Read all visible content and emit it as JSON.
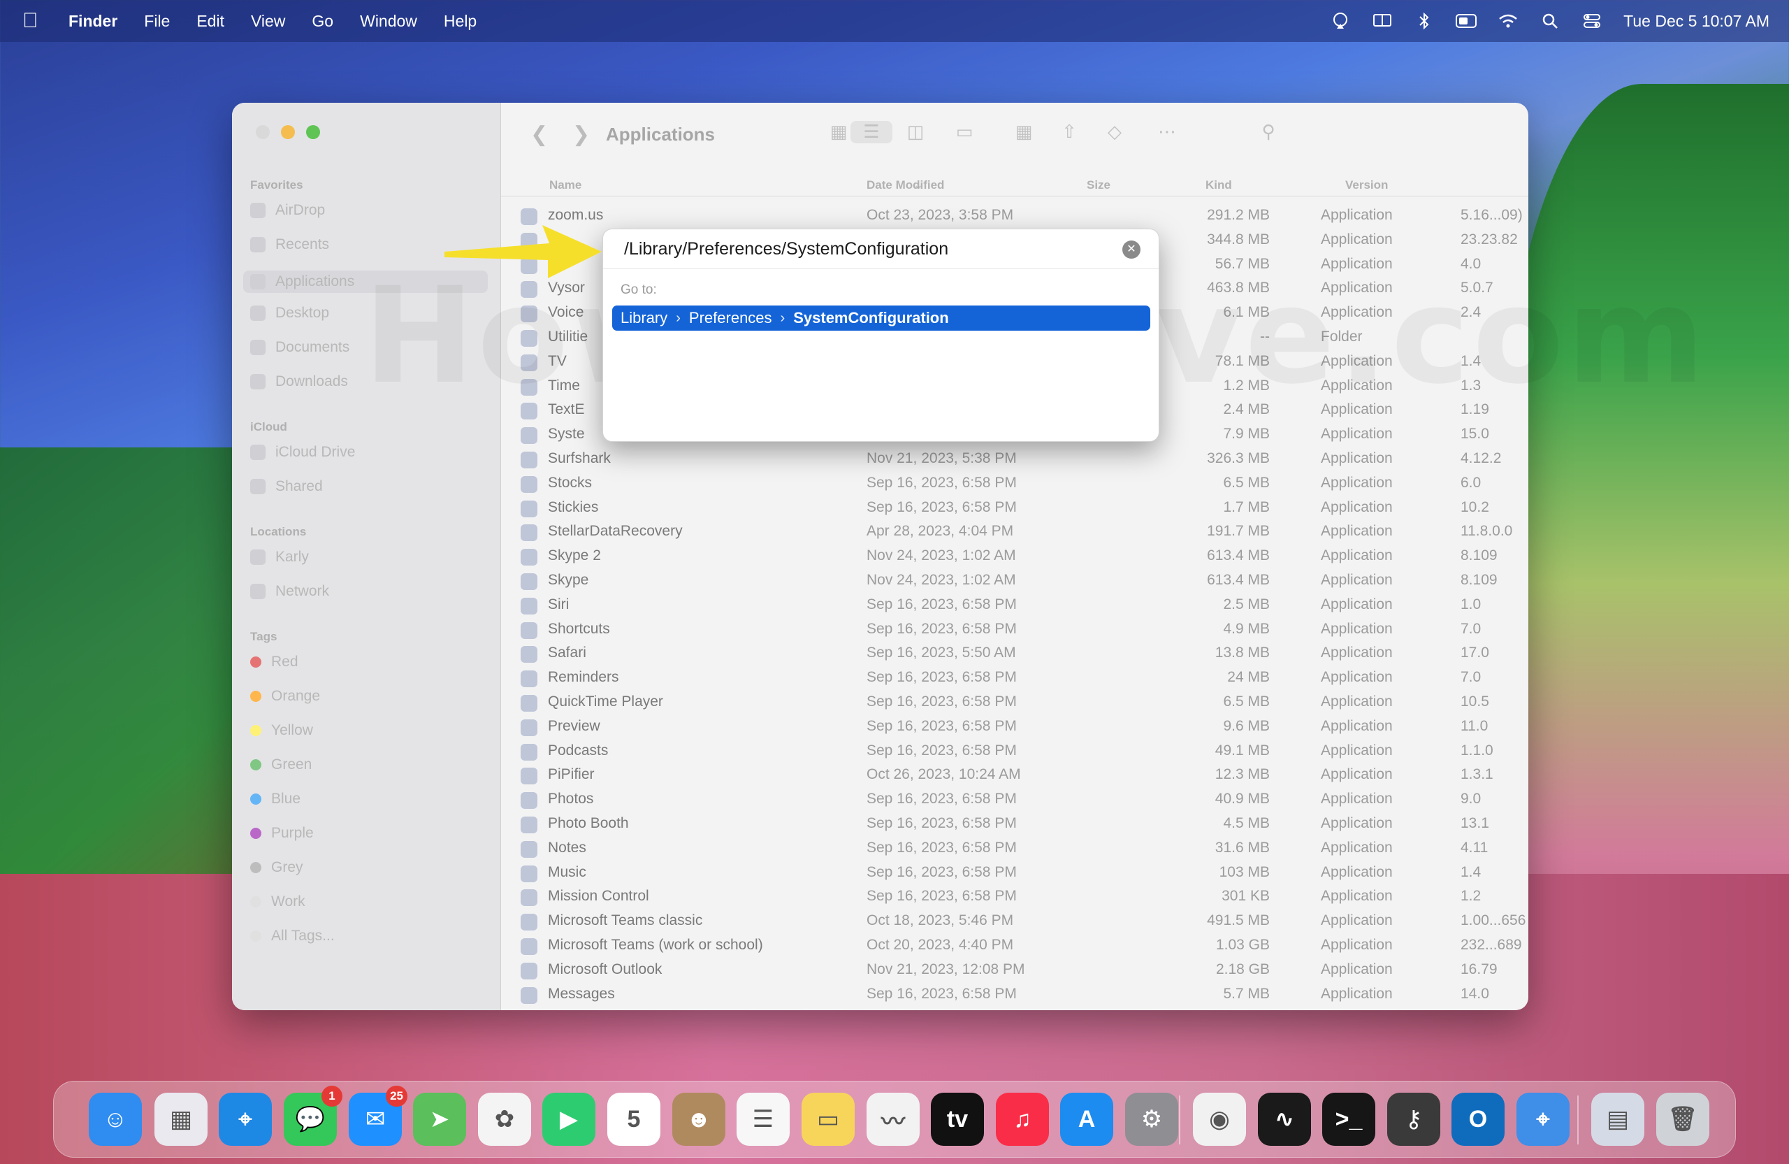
{
  "menubar": {
    "app": "Finder",
    "menus": [
      "File",
      "Edit",
      "View",
      "Go",
      "Window",
      "Help"
    ],
    "clock": "Tue Dec 5  10:07 AM",
    "status_icons": [
      "airplay-icon",
      "screen-mirroring-icon",
      "bluetooth-icon",
      "battery-icon",
      "wifi-icon",
      "search-icon",
      "control-center-icon"
    ]
  },
  "window": {
    "title": "Applications",
    "sidebar": {
      "favorites_label": "Favorites",
      "favorites": [
        "AirDrop",
        "Recents",
        "Applications",
        "Desktop",
        "Documents",
        "Downloads"
      ],
      "icloud_label": "iCloud",
      "icloud": [
        "iCloud Drive",
        "Shared"
      ],
      "locations_label": "Locations",
      "locations": [
        "Karly",
        "Network"
      ],
      "tags_label": "Tags",
      "tags": [
        "Red",
        "Orange",
        "Yellow",
        "Green",
        "Blue",
        "Purple",
        "Grey",
        "Work",
        "All Tags..."
      ],
      "tag_colors": [
        "#e57373",
        "#ffb74d",
        "#fff176",
        "#81c784",
        "#64b5f6",
        "#ba68c8",
        "#bdbdbd",
        "#e0e0e0",
        "#e0e0e0"
      ]
    },
    "columns": {
      "name": "Name",
      "date": "Date Modified",
      "size": "Size",
      "kind": "Kind",
      "version": "Version"
    },
    "rows": [
      {
        "name": "zoom.us",
        "date": "Oct 23, 2023, 3:58 PM",
        "size": "291.2 MB",
        "kind": "Application",
        "version": "5.16...09)"
      },
      {
        "name": "",
        "date": "",
        "size": "344.8 MB",
        "kind": "Application",
        "version": "23.23.82"
      },
      {
        "name": "",
        "date": "",
        "size": "56.7 MB",
        "kind": "Application",
        "version": "4.0"
      },
      {
        "name": "Vysor",
        "date": "",
        "size": "463.8 MB",
        "kind": "Application",
        "version": "5.0.7"
      },
      {
        "name": "Voice",
        "date": "",
        "size": "6.1 MB",
        "kind": "Application",
        "version": "2.4"
      },
      {
        "name": "Utilitie",
        "date": "",
        "size": "--",
        "kind": "Folder",
        "version": ""
      },
      {
        "name": "TV",
        "date": "",
        "size": "78.1 MB",
        "kind": "Application",
        "version": "1.4"
      },
      {
        "name": "Time",
        "date": "",
        "size": "1.2 MB",
        "kind": "Application",
        "version": "1.3"
      },
      {
        "name": "TextE",
        "date": "",
        "size": "2.4 MB",
        "kind": "Application",
        "version": "1.19"
      },
      {
        "name": "Syste",
        "date": "",
        "size": "7.9 MB",
        "kind": "Application",
        "version": "15.0"
      },
      {
        "name": "Surfshark",
        "date": "Nov 21, 2023, 5:38 PM",
        "size": "326.3 MB",
        "kind": "Application",
        "version": "4.12.2"
      },
      {
        "name": "Stocks",
        "date": "Sep 16, 2023, 6:58 PM",
        "size": "6.5 MB",
        "kind": "Application",
        "version": "6.0"
      },
      {
        "name": "Stickies",
        "date": "Sep 16, 2023, 6:58 PM",
        "size": "1.7 MB",
        "kind": "Application",
        "version": "10.2"
      },
      {
        "name": "StellarDataRecovery",
        "date": "Apr 28, 2023, 4:04 PM",
        "size": "191.7 MB",
        "kind": "Application",
        "version": "11.8.0.0"
      },
      {
        "name": "Skype 2",
        "date": "Nov 24, 2023, 1:02 AM",
        "size": "613.4 MB",
        "kind": "Application",
        "version": "8.109"
      },
      {
        "name": "Skype",
        "date": "Nov 24, 2023, 1:02 AM",
        "size": "613.4 MB",
        "kind": "Application",
        "version": "8.109"
      },
      {
        "name": "Siri",
        "date": "Sep 16, 2023, 6:58 PM",
        "size": "2.5 MB",
        "kind": "Application",
        "version": "1.0"
      },
      {
        "name": "Shortcuts",
        "date": "Sep 16, 2023, 6:58 PM",
        "size": "4.9 MB",
        "kind": "Application",
        "version": "7.0"
      },
      {
        "name": "Safari",
        "date": "Sep 16, 2023, 5:50 AM",
        "size": "13.8 MB",
        "kind": "Application",
        "version": "17.0"
      },
      {
        "name": "Reminders",
        "date": "Sep 16, 2023, 6:58 PM",
        "size": "24 MB",
        "kind": "Application",
        "version": "7.0"
      },
      {
        "name": "QuickTime Player",
        "date": "Sep 16, 2023, 6:58 PM",
        "size": "6.5 MB",
        "kind": "Application",
        "version": "10.5"
      },
      {
        "name": "Preview",
        "date": "Sep 16, 2023, 6:58 PM",
        "size": "9.6 MB",
        "kind": "Application",
        "version": "11.0"
      },
      {
        "name": "Podcasts",
        "date": "Sep 16, 2023, 6:58 PM",
        "size": "49.1 MB",
        "kind": "Application",
        "version": "1.1.0"
      },
      {
        "name": "PiPifier",
        "date": "Oct 26, 2023, 10:24 AM",
        "size": "12.3 MB",
        "kind": "Application",
        "version": "1.3.1"
      },
      {
        "name": "Photos",
        "date": "Sep 16, 2023, 6:58 PM",
        "size": "40.9 MB",
        "kind": "Application",
        "version": "9.0"
      },
      {
        "name": "Photo Booth",
        "date": "Sep 16, 2023, 6:58 PM",
        "size": "4.5 MB",
        "kind": "Application",
        "version": "13.1"
      },
      {
        "name": "Notes",
        "date": "Sep 16, 2023, 6:58 PM",
        "size": "31.6 MB",
        "kind": "Application",
        "version": "4.11"
      },
      {
        "name": "Music",
        "date": "Sep 16, 2023, 6:58 PM",
        "size": "103 MB",
        "kind": "Application",
        "version": "1.4"
      },
      {
        "name": "Mission Control",
        "date": "Sep 16, 2023, 6:58 PM",
        "size": "301 KB",
        "kind": "Application",
        "version": "1.2"
      },
      {
        "name": "Microsoft Teams classic",
        "date": "Oct 18, 2023, 5:46 PM",
        "size": "491.5 MB",
        "kind": "Application",
        "version": "1.00...656"
      },
      {
        "name": "Microsoft Teams (work or school)",
        "date": "Oct 20, 2023, 4:40 PM",
        "size": "1.03 GB",
        "kind": "Application",
        "version": "232...689"
      },
      {
        "name": "Microsoft Outlook",
        "date": "Nov 21, 2023, 12:08 PM",
        "size": "2.18 GB",
        "kind": "Application",
        "version": "16.79"
      },
      {
        "name": "Messages",
        "date": "Sep 16, 2023, 6:58 PM",
        "size": "5.7 MB",
        "kind": "Application",
        "version": "14.0"
      }
    ]
  },
  "goto": {
    "field_value": "/Library/Preferences/SystemConfiguration",
    "label": "Go to:",
    "suggestion": [
      "Library",
      "Preferences",
      "SystemConfiguration"
    ]
  },
  "watermark": "HowToiSolve.com",
  "dock": {
    "apps": [
      {
        "name": "finder-icon",
        "color": "#2f8cf0",
        "glyph": "☺",
        "badge": ""
      },
      {
        "name": "launchpad-icon",
        "color": "#e9e9ef",
        "glyph": "▦",
        "badge": ""
      },
      {
        "name": "safari-icon",
        "color": "#1e88e5",
        "glyph": "⌖",
        "badge": ""
      },
      {
        "name": "messages-icon",
        "color": "#34c759",
        "glyph": "💬",
        "badge": "1"
      },
      {
        "name": "mail-icon",
        "color": "#1e90ff",
        "glyph": "✉",
        "badge": "25"
      },
      {
        "name": "maps-icon",
        "color": "#5bbf5b",
        "glyph": "➤",
        "badge": ""
      },
      {
        "name": "photos-icon",
        "color": "#f4f4f4",
        "glyph": "✿",
        "badge": ""
      },
      {
        "name": "facetime-icon",
        "color": "#2ecc71",
        "glyph": "▶",
        "badge": ""
      },
      {
        "name": "calendar-icon",
        "color": "#ffffff",
        "glyph": "5",
        "badge": ""
      },
      {
        "name": "contacts-icon",
        "color": "#b08a5f",
        "glyph": "☻",
        "badge": ""
      },
      {
        "name": "reminders-icon",
        "color": "#f7f7f7",
        "glyph": "☰",
        "badge": ""
      },
      {
        "name": "notes-icon",
        "color": "#f7d55b",
        "glyph": "▭",
        "badge": ""
      },
      {
        "name": "freeform-icon",
        "color": "#f2f2f2",
        "glyph": "〰",
        "badge": ""
      },
      {
        "name": "apple-tv-icon",
        "color": "#111111",
        "glyph": "tv",
        "badge": ""
      },
      {
        "name": "music-icon",
        "color": "#fa2d48",
        "glyph": "♫",
        "badge": ""
      },
      {
        "name": "app-store-icon",
        "color": "#1c8cf0",
        "glyph": "A",
        "badge": ""
      },
      {
        "name": "system-settings-icon",
        "color": "#8e8e93",
        "glyph": "⚙",
        "badge": ""
      },
      {
        "name": "chrome-icon",
        "color": "#f1f1f1",
        "glyph": "◉",
        "badge": ""
      },
      {
        "name": "activity-monitor-icon",
        "color": "#1a1a1a",
        "glyph": "∿",
        "badge": ""
      },
      {
        "name": "terminal-icon",
        "color": "#161616",
        "glyph": ">_",
        "badge": ""
      },
      {
        "name": "keychain-icon",
        "color": "#3a3a3a",
        "glyph": "⚷",
        "badge": ""
      },
      {
        "name": "outlook-icon",
        "color": "#0f6cbd",
        "glyph": "O",
        "badge": ""
      },
      {
        "name": "safari-technology-icon",
        "color": "#3f8ee8",
        "glyph": "⌖",
        "badge": ""
      },
      {
        "name": "downloads-stack-icon",
        "color": "#d5dbe6",
        "glyph": "▤",
        "badge": ""
      },
      {
        "name": "trash-icon",
        "color": "#cfd3d8",
        "glyph": "🗑",
        "badge": ""
      }
    ]
  },
  "accent_color": "#1464d8",
  "arrow_color": "#f6df2b"
}
